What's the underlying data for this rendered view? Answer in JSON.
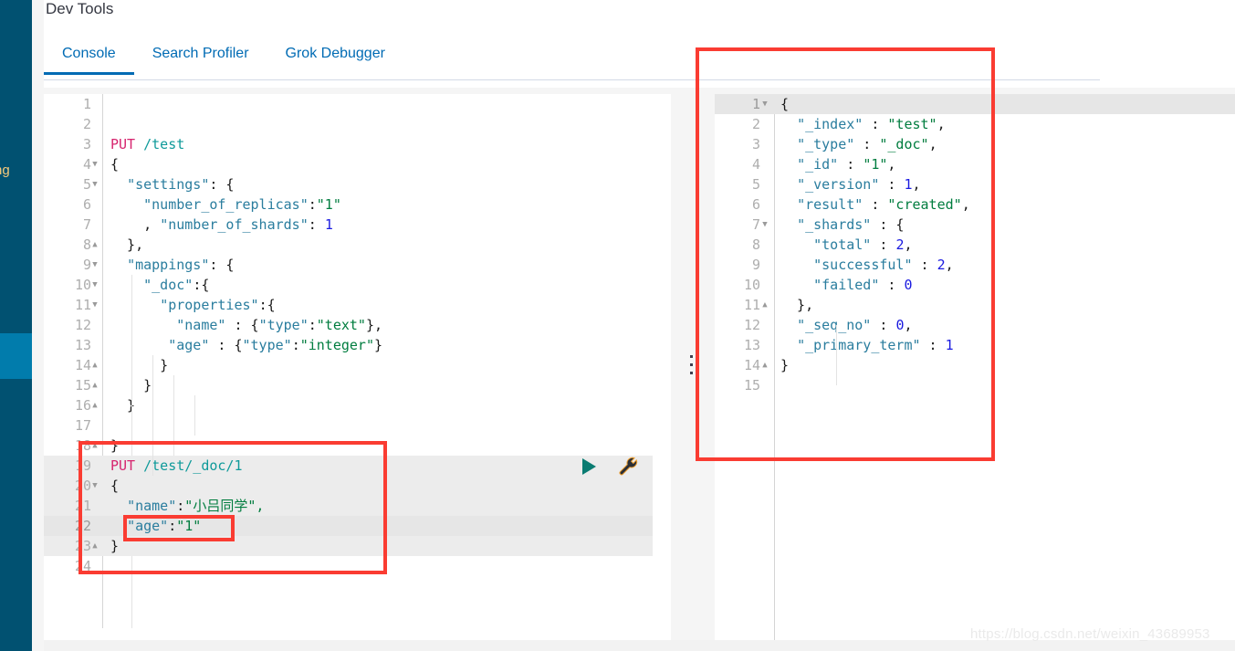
{
  "nav": {
    "partial_label": "ng",
    "rail_color": "#015171",
    "rail_active_color": "#017cac"
  },
  "header": {
    "title": "Dev Tools"
  },
  "tabs": [
    {
      "label": "Console",
      "active": true
    },
    {
      "label": "Search Profiler",
      "active": false
    },
    {
      "label": "Grok Debugger",
      "active": false
    }
  ],
  "toolbar": {
    "play_icon": "play-icon",
    "wrench_icon": "wrench-icon",
    "splitter_icon": "drag-handle-icon"
  },
  "request_editor": {
    "name": "console-request-editor",
    "lines": [
      {
        "n": 1,
        "fold": "",
        "hl": "none",
        "tokens": []
      },
      {
        "n": 2,
        "fold": "",
        "hl": "none",
        "tokens": []
      },
      {
        "n": 3,
        "fold": "",
        "hl": "none",
        "tokens": [
          {
            "t": "PUT",
            "c": "t-method"
          },
          {
            "t": " ",
            "c": "t-plain"
          },
          {
            "t": "/test",
            "c": "t-url"
          }
        ]
      },
      {
        "n": 4,
        "fold": "down",
        "hl": "none",
        "tokens": [
          {
            "t": "{",
            "c": "t-punct"
          }
        ]
      },
      {
        "n": 5,
        "fold": "down",
        "hl": "none",
        "tokens": [
          {
            "t": "  ",
            "c": "t-plain"
          },
          {
            "t": "\"settings\"",
            "c": "t-key"
          },
          {
            "t": ": {",
            "c": "t-punct"
          }
        ]
      },
      {
        "n": 6,
        "fold": "",
        "hl": "none",
        "tokens": [
          {
            "t": "    ",
            "c": "t-plain"
          },
          {
            "t": "\"number_of_replicas\"",
            "c": "t-key"
          },
          {
            "t": ":",
            "c": "t-punct"
          },
          {
            "t": "\"1\"",
            "c": "t-str"
          }
        ]
      },
      {
        "n": 7,
        "fold": "",
        "hl": "none",
        "tokens": [
          {
            "t": "    , ",
            "c": "t-punct"
          },
          {
            "t": "\"number_of_shards\"",
            "c": "t-key"
          },
          {
            "t": ": ",
            "c": "t-punct"
          },
          {
            "t": "1",
            "c": "t-num"
          }
        ]
      },
      {
        "n": 8,
        "fold": "up",
        "hl": "none",
        "tokens": [
          {
            "t": "  },",
            "c": "t-punct"
          }
        ]
      },
      {
        "n": 9,
        "fold": "down",
        "hl": "none",
        "tokens": [
          {
            "t": "  ",
            "c": "t-plain"
          },
          {
            "t": "\"mappings\"",
            "c": "t-key"
          },
          {
            "t": ": {",
            "c": "t-punct"
          }
        ]
      },
      {
        "n": 10,
        "fold": "down",
        "hl": "none",
        "tokens": [
          {
            "t": "    ",
            "c": "t-plain"
          },
          {
            "t": "\"_doc\"",
            "c": "t-key"
          },
          {
            "t": ":{",
            "c": "t-punct"
          }
        ]
      },
      {
        "n": 11,
        "fold": "down",
        "hl": "none",
        "tokens": [
          {
            "t": "      ",
            "c": "t-plain"
          },
          {
            "t": "\"properties\"",
            "c": "t-key"
          },
          {
            "t": ":{",
            "c": "t-punct"
          }
        ]
      },
      {
        "n": 12,
        "fold": "",
        "hl": "none",
        "tokens": [
          {
            "t": "        ",
            "c": "t-plain"
          },
          {
            "t": "\"name\"",
            "c": "t-key"
          },
          {
            "t": " : {",
            "c": "t-punct"
          },
          {
            "t": "\"type\"",
            "c": "t-key"
          },
          {
            "t": ":",
            "c": "t-punct"
          },
          {
            "t": "\"text\"",
            "c": "t-str"
          },
          {
            "t": "},",
            "c": "t-punct"
          }
        ]
      },
      {
        "n": 13,
        "fold": "",
        "hl": "none",
        "tokens": [
          {
            "t": "       ",
            "c": "t-plain"
          },
          {
            "t": "\"age\"",
            "c": "t-key"
          },
          {
            "t": " : {",
            "c": "t-punct"
          },
          {
            "t": "\"type\"",
            "c": "t-key"
          },
          {
            "t": ":",
            "c": "t-punct"
          },
          {
            "t": "\"integer\"",
            "c": "t-str"
          },
          {
            "t": "}",
            "c": "t-punct"
          }
        ]
      },
      {
        "n": 14,
        "fold": "up",
        "hl": "none",
        "tokens": [
          {
            "t": "      }",
            "c": "t-punct"
          }
        ]
      },
      {
        "n": 15,
        "fold": "up",
        "hl": "none",
        "tokens": [
          {
            "t": "    }",
            "c": "t-punct"
          }
        ]
      },
      {
        "n": 16,
        "fold": "up",
        "hl": "none",
        "tokens": [
          {
            "t": "  }",
            "c": "t-punct"
          }
        ]
      },
      {
        "n": 17,
        "fold": "",
        "hl": "none",
        "tokens": []
      },
      {
        "n": 18,
        "fold": "up",
        "hl": "none",
        "tokens": [
          {
            "t": "}",
            "c": "t-punct"
          }
        ]
      },
      {
        "n": 19,
        "fold": "",
        "hl": "soft",
        "tokens": [
          {
            "t": "PUT",
            "c": "t-method"
          },
          {
            "t": " ",
            "c": "t-plain"
          },
          {
            "t": "/test/_doc/1",
            "c": "t-url"
          }
        ]
      },
      {
        "n": 20,
        "fold": "down",
        "hl": "soft",
        "tokens": [
          {
            "t": "{",
            "c": "t-punct"
          }
        ]
      },
      {
        "n": 21,
        "fold": "",
        "hl": "soft",
        "tokens": [
          {
            "t": "  ",
            "c": "t-plain"
          },
          {
            "t": "\"name\"",
            "c": "t-key"
          },
          {
            "t": ":",
            "c": "t-punct"
          },
          {
            "t": "\"",
            "c": "t-str"
          },
          {
            "t": "小吕同学",
            "c": "t-cjk"
          },
          {
            "t": "\",",
            "c": "t-str"
          }
        ]
      },
      {
        "n": 22,
        "fold": "",
        "hl": "strong",
        "tokens": [
          {
            "t": "  ",
            "c": "t-plain"
          },
          {
            "t": "\"age\"",
            "c": "t-key"
          },
          {
            "t": ":",
            "c": "t-punct"
          },
          {
            "t": "\"1\"",
            "c": "t-str"
          }
        ]
      },
      {
        "n": 23,
        "fold": "up",
        "hl": "soft",
        "tokens": [
          {
            "t": "}",
            "c": "t-punct"
          }
        ]
      },
      {
        "n": 24,
        "fold": "",
        "hl": "none",
        "tokens": []
      }
    ]
  },
  "response_editor": {
    "name": "console-response-viewer",
    "lines": [
      {
        "n": 1,
        "fold": "down",
        "hl": "strong",
        "tokens": [
          {
            "t": "{",
            "c": "t-punct"
          }
        ]
      },
      {
        "n": 2,
        "fold": "",
        "hl": "none",
        "tokens": [
          {
            "t": "  ",
            "c": "t-plain"
          },
          {
            "t": "\"_index\"",
            "c": "t-key"
          },
          {
            "t": " : ",
            "c": "t-punct"
          },
          {
            "t": "\"test\"",
            "c": "t-str"
          },
          {
            "t": ",",
            "c": "t-punct"
          }
        ]
      },
      {
        "n": 3,
        "fold": "",
        "hl": "none",
        "tokens": [
          {
            "t": "  ",
            "c": "t-plain"
          },
          {
            "t": "\"_type\"",
            "c": "t-key"
          },
          {
            "t": " : ",
            "c": "t-punct"
          },
          {
            "t": "\"_doc\"",
            "c": "t-str"
          },
          {
            "t": ",",
            "c": "t-punct"
          }
        ]
      },
      {
        "n": 4,
        "fold": "",
        "hl": "none",
        "tokens": [
          {
            "t": "  ",
            "c": "t-plain"
          },
          {
            "t": "\"_id\"",
            "c": "t-key"
          },
          {
            "t": " : ",
            "c": "t-punct"
          },
          {
            "t": "\"1\"",
            "c": "t-str"
          },
          {
            "t": ",",
            "c": "t-punct"
          }
        ]
      },
      {
        "n": 5,
        "fold": "",
        "hl": "none",
        "tokens": [
          {
            "t": "  ",
            "c": "t-plain"
          },
          {
            "t": "\"_version\"",
            "c": "t-key"
          },
          {
            "t": " : ",
            "c": "t-punct"
          },
          {
            "t": "1",
            "c": "t-num"
          },
          {
            "t": ",",
            "c": "t-punct"
          }
        ]
      },
      {
        "n": 6,
        "fold": "",
        "hl": "none",
        "tokens": [
          {
            "t": "  ",
            "c": "t-plain"
          },
          {
            "t": "\"result\"",
            "c": "t-key"
          },
          {
            "t": " : ",
            "c": "t-punct"
          },
          {
            "t": "\"created\"",
            "c": "t-str"
          },
          {
            "t": ",",
            "c": "t-punct"
          }
        ]
      },
      {
        "n": 7,
        "fold": "down",
        "hl": "none",
        "tokens": [
          {
            "t": "  ",
            "c": "t-plain"
          },
          {
            "t": "\"_shards\"",
            "c": "t-key"
          },
          {
            "t": " : {",
            "c": "t-punct"
          }
        ]
      },
      {
        "n": 8,
        "fold": "",
        "hl": "none",
        "tokens": [
          {
            "t": "    ",
            "c": "t-plain"
          },
          {
            "t": "\"total\"",
            "c": "t-key"
          },
          {
            "t": " : ",
            "c": "t-punct"
          },
          {
            "t": "2",
            "c": "t-num"
          },
          {
            "t": ",",
            "c": "t-punct"
          }
        ]
      },
      {
        "n": 9,
        "fold": "",
        "hl": "none",
        "tokens": [
          {
            "t": "    ",
            "c": "t-plain"
          },
          {
            "t": "\"successful\"",
            "c": "t-key"
          },
          {
            "t": " : ",
            "c": "t-punct"
          },
          {
            "t": "2",
            "c": "t-num"
          },
          {
            "t": ",",
            "c": "t-punct"
          }
        ]
      },
      {
        "n": 10,
        "fold": "",
        "hl": "none",
        "tokens": [
          {
            "t": "    ",
            "c": "t-plain"
          },
          {
            "t": "\"failed\"",
            "c": "t-key"
          },
          {
            "t": " : ",
            "c": "t-punct"
          },
          {
            "t": "0",
            "c": "t-num"
          }
        ]
      },
      {
        "n": 11,
        "fold": "up",
        "hl": "none",
        "tokens": [
          {
            "t": "  },",
            "c": "t-punct"
          }
        ]
      },
      {
        "n": 12,
        "fold": "",
        "hl": "none",
        "tokens": [
          {
            "t": "  ",
            "c": "t-plain"
          },
          {
            "t": "\"_seq_no\"",
            "c": "t-key"
          },
          {
            "t": " : ",
            "c": "t-punct"
          },
          {
            "t": "0",
            "c": "t-num"
          },
          {
            "t": ",",
            "c": "t-punct"
          }
        ]
      },
      {
        "n": 13,
        "fold": "",
        "hl": "none",
        "tokens": [
          {
            "t": "  ",
            "c": "t-plain"
          },
          {
            "t": "\"_primary_term\"",
            "c": "t-key"
          },
          {
            "t": " : ",
            "c": "t-punct"
          },
          {
            "t": "1",
            "c": "t-num"
          }
        ]
      },
      {
        "n": 14,
        "fold": "up",
        "hl": "none",
        "tokens": [
          {
            "t": "}",
            "c": "t-punct"
          }
        ]
      },
      {
        "n": 15,
        "fold": "",
        "hl": "none",
        "tokens": []
      }
    ]
  },
  "annotations": {
    "box_color": "#fa3c32",
    "request_box": "highlight-around-put-doc-request",
    "age_box": "highlight-around-age-field",
    "response_box": "highlight-around-response"
  },
  "watermark": {
    "text": "https://blog.csdn.net/weixin_43689953"
  }
}
